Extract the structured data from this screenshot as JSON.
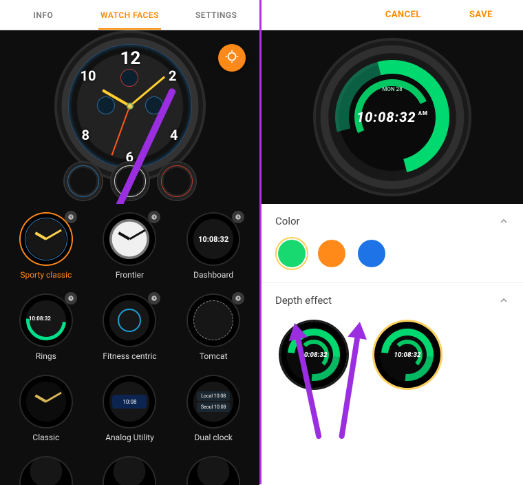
{
  "left": {
    "tabs": [
      {
        "label": "INFO",
        "selected": false
      },
      {
        "label": "WATCH FACES",
        "selected": true
      },
      {
        "label": "SETTINGS",
        "selected": false
      }
    ],
    "hero": {
      "numerals": {
        "n12": "12",
        "n2": "2",
        "n4": "4",
        "n6": "6",
        "n8": "8",
        "n10": "10"
      },
      "variants_count": 3
    },
    "faces": [
      {
        "label": "Sporty classic",
        "kind": "sporty",
        "selected": true,
        "badge": true
      },
      {
        "label": "Frontier",
        "kind": "frontier",
        "selected": false,
        "badge": true
      },
      {
        "label": "Dashboard",
        "kind": "dash",
        "selected": false,
        "badge": true,
        "time": "10:08:32"
      },
      {
        "label": "Rings",
        "kind": "rings",
        "selected": false,
        "badge": true,
        "time": "10:08:32"
      },
      {
        "label": "Fitness centric",
        "kind": "fit",
        "selected": false,
        "badge": true
      },
      {
        "label": "Tomcat",
        "kind": "tom",
        "selected": false,
        "badge": true
      },
      {
        "label": "Classic",
        "kind": "class",
        "selected": false,
        "badge": false
      },
      {
        "label": "Analog Utility",
        "kind": "anut",
        "selected": false,
        "badge": false,
        "time": "10:08"
      },
      {
        "label": "Dual clock",
        "kind": "dual",
        "selected": false,
        "badge": false,
        "t1": "10:08",
        "t2": "10:08",
        "c1": "Local",
        "c2": "Seoul"
      }
    ]
  },
  "right": {
    "actions": {
      "cancel": "CANCEL",
      "save": "SAVE"
    },
    "hero": {
      "time": "10:08:32",
      "ampm": "AM",
      "date": "MON 28"
    },
    "sections": {
      "color": {
        "title": "Color",
        "swatches": [
          {
            "name": "green",
            "hex": "#18d96f",
            "selected": true
          },
          {
            "name": "orange",
            "hex": "#ff8a1a",
            "selected": false
          },
          {
            "name": "blue",
            "hex": "#1e74e6",
            "selected": false
          }
        ]
      },
      "depth": {
        "title": "Depth effect",
        "options": [
          {
            "time": "10:08:32",
            "selected": false
          },
          {
            "time": "10:08:32",
            "selected": true
          }
        ]
      }
    }
  },
  "colors": {
    "accent": "#ff8a00",
    "annotation_purple": "#9b2ee0"
  }
}
